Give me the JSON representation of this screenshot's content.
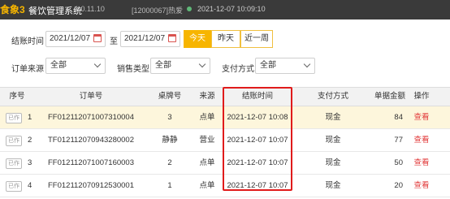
{
  "titlebar": {
    "logo": "食象3",
    "app_name": "餐饮管理系统",
    "version": "1.0.11.10",
    "store": "[12000067]热爱",
    "clock": "2021-12-07 10:09:10"
  },
  "filters": {
    "settle_time_label": "结账时间",
    "date_from": "2021/12/07",
    "date_to_sep": "至",
    "date_to": "2021/12/07",
    "quick": {
      "today": "今天",
      "yesterday": "昨天",
      "week": "近一周"
    },
    "order_source_label": "订单来源",
    "order_source_value": "全部",
    "sale_type_label": "销售类型",
    "sale_type_value": "全部",
    "pay_method_label": "支付方式",
    "pay_method_value": "全部"
  },
  "table": {
    "headers": {
      "seq": "序号",
      "order_no": "订单号",
      "table_no": "桌牌号",
      "source": "来源",
      "settle_time": "结账时间",
      "pay": "支付方式",
      "amount": "单据金额",
      "action": "操作"
    },
    "rows": [
      {
        "badge": "已作",
        "seq": "1",
        "order_no": "FF012112071007310004",
        "table_no": "3",
        "source": "点单",
        "settle_time": "2021-12-07 10:08",
        "pay": "现金",
        "amount": "84",
        "action": "查看"
      },
      {
        "badge": "已作",
        "seq": "2",
        "order_no": "TF012112070943280002",
        "table_no": "静静",
        "source": "营业",
        "settle_time": "2021-12-07 10:07",
        "pay": "现金",
        "amount": "77",
        "action": "查看"
      },
      {
        "badge": "已作",
        "seq": "3",
        "order_no": "FF012112071007160003",
        "table_no": "2",
        "source": "点单",
        "settle_time": "2021-12-07 10:07",
        "pay": "现金",
        "amount": "50",
        "action": "查看"
      },
      {
        "badge": "已作",
        "seq": "4",
        "order_no": "FF012112070912530001",
        "table_no": "1",
        "source": "点单",
        "settle_time": "2021-12-07 10:07",
        "pay": "现金",
        "amount": "20",
        "action": "查看"
      }
    ]
  },
  "colors": {
    "accent": "#f7b500",
    "link": "#e23b3b",
    "highlight": "#e01b1b"
  }
}
